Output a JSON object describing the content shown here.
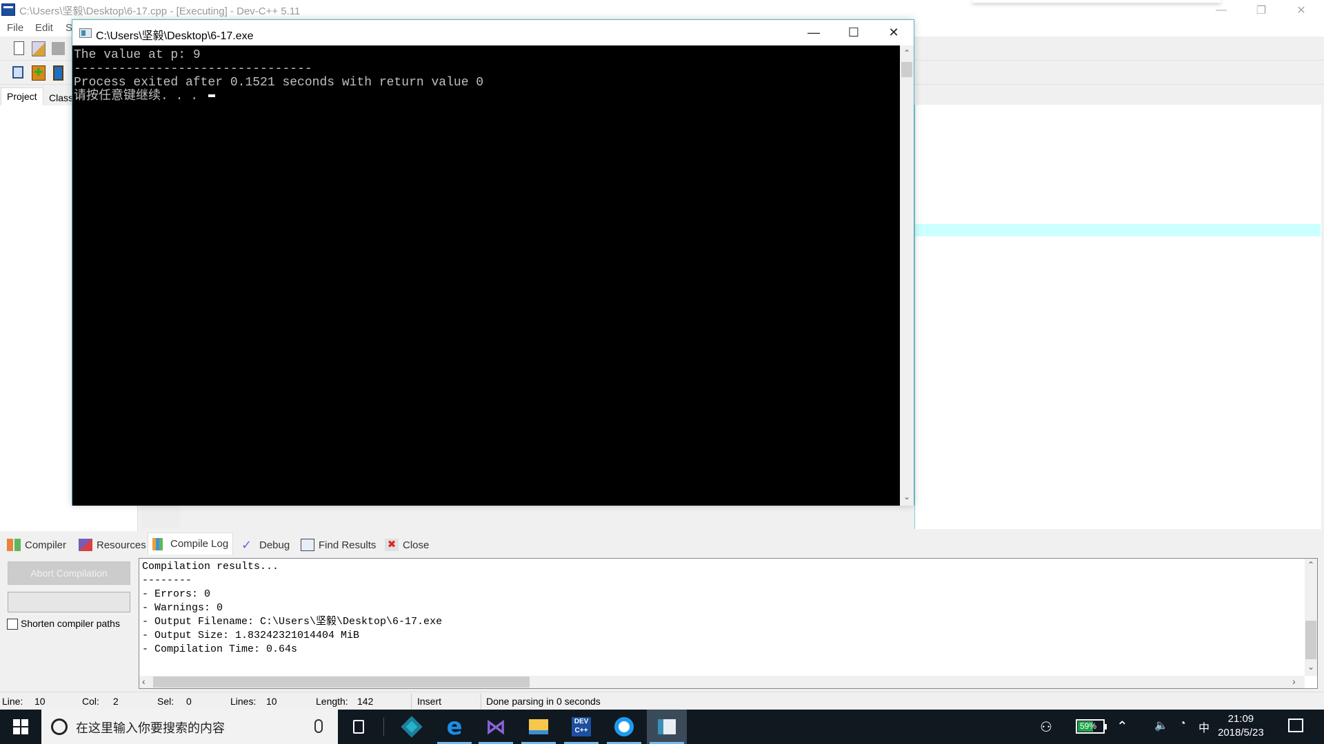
{
  "main_window": {
    "title": "C:\\Users\\坚毅\\Desktop\\6-17.cpp - [Executing] - Dev-C++ 5.11",
    "minimize": "—",
    "restore": "❐",
    "close": "✕"
  },
  "menu": [
    "File",
    "Edit",
    "S"
  ],
  "left_tabs": [
    "Project",
    "Class"
  ],
  "console": {
    "title": "C:\\Users\\坚毅\\Desktop\\6-17.exe",
    "minimize": "—",
    "maximize": "☐",
    "close": "✕",
    "lines": [
      "The value at p: 9",
      "--------------------------------",
      "Process exited after 0.1521 seconds with return value 0",
      "请按任意键继续. . . "
    ],
    "scroll_up": "⌃",
    "scroll_down": "⌄"
  },
  "bottom_tabs": [
    {
      "label": "Compiler",
      "icon": "compiler-icon"
    },
    {
      "label": "Resources",
      "icon": "resources-icon"
    },
    {
      "label": "Compile Log",
      "icon": "compile-log-icon",
      "active": true
    },
    {
      "label": "Debug",
      "icon": "debug-icon"
    },
    {
      "label": "Find Results",
      "icon": "find-results-icon"
    },
    {
      "label": "Close",
      "icon": "close-panel-icon"
    }
  ],
  "compile_panel": {
    "abort_label": "Abort Compilation",
    "shorten_label": "Shorten compiler paths",
    "shorten_checked": false,
    "log_lines": [
      "Compilation results...",
      "--------",
      "- Errors: 0",
      "- Warnings: 0",
      "- Output Filename: C:\\Users\\坚毅\\Desktop\\6-17.exe",
      "- Output Size: 1.83242321014404 MiB",
      "- Compilation Time: 0.64s"
    ]
  },
  "status_bar": {
    "line_label": "Line:",
    "line_value": "10",
    "col_label": "Col:",
    "col_value": "2",
    "sel_label": "Sel:",
    "sel_value": "0",
    "lines_label": "Lines:",
    "lines_value": "10",
    "length_label": "Length:",
    "length_value": "142",
    "mode": "Insert",
    "message": "Done parsing in 0 seconds"
  },
  "taskbar": {
    "search_placeholder": "在这里输入你要搜索的内容",
    "battery_percent": "59%",
    "ime": "中",
    "time": "21:09",
    "date": "2018/5/23"
  },
  "colors": {
    "console_bg": "#000000",
    "console_text": "#c0c0c0",
    "editor_highlight": "#ccffff",
    "battery_fill": "#1fa34a",
    "taskbar_bg": "#101820"
  }
}
